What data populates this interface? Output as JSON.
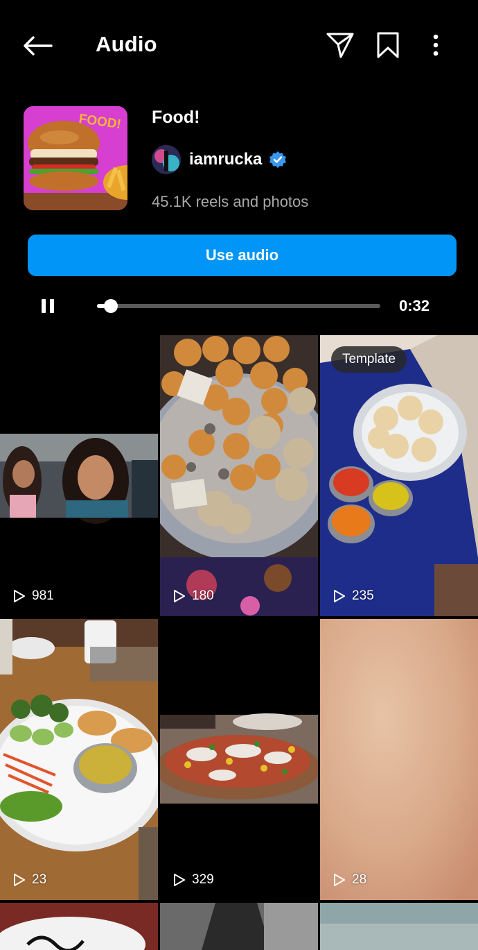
{
  "header": {
    "title": "Audio",
    "back_icon": "arrow-left-icon",
    "share_icon": "paper-plane-icon",
    "save_icon": "bookmark-icon",
    "more_icon": "more-vertical-icon"
  },
  "audio": {
    "cover_text": "FOOD!",
    "title": "Food!",
    "artist": "iamrucka",
    "verified": true,
    "count_text": "45.1K reels and photos"
  },
  "actions": {
    "use_audio_label": "Use audio"
  },
  "player": {
    "state": "playing",
    "progress": 0.05,
    "time": "0:32"
  },
  "grid": {
    "items": [
      {
        "views": "981",
        "template": ""
      },
      {
        "views": "180",
        "template": ""
      },
      {
        "views": "235",
        "template": "Template"
      },
      {
        "views": "23",
        "template": ""
      },
      {
        "views": "329",
        "template": ""
      },
      {
        "views": "28",
        "template": ""
      }
    ]
  },
  "colors": {
    "accent": "#0095f6",
    "background": "#000000",
    "secondary_text": "#a8a8a8"
  }
}
